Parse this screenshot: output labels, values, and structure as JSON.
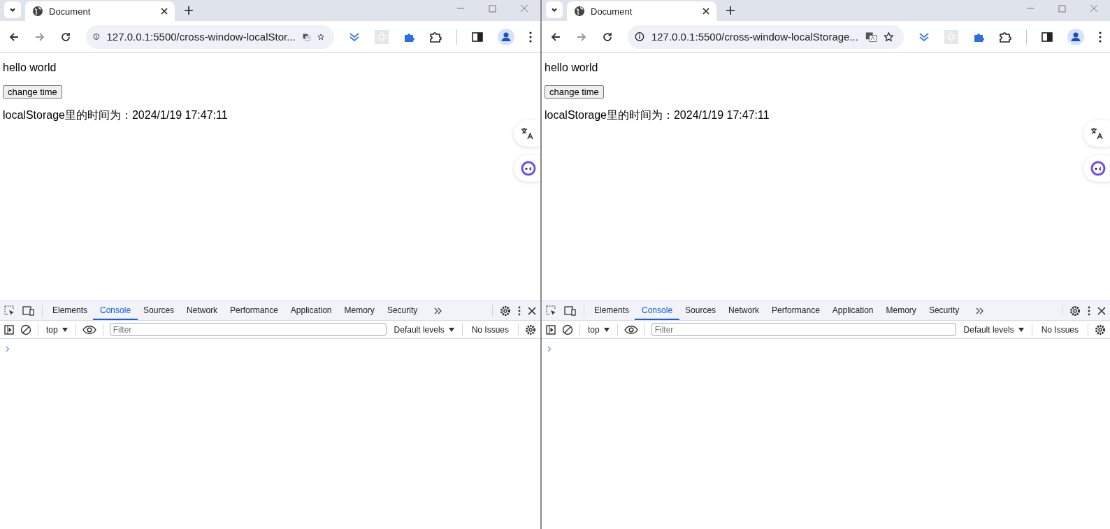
{
  "windows": [
    {
      "tab_title": "Document",
      "url": "127.0.0.1:5500/cross-window-localStor...",
      "page": {
        "heading": "hello world",
        "button": "change time",
        "storage_line": "localStorage里的时间为：2024/1/19 17:47:11"
      },
      "devtools": {
        "tabs": [
          {
            "label": "Elements",
            "selected": false
          },
          {
            "label": "Console",
            "selected": true
          },
          {
            "label": "Sources",
            "selected": false
          },
          {
            "label": "Network",
            "selected": false
          },
          {
            "label": "Performance",
            "selected": false
          },
          {
            "label": "Application",
            "selected": false
          },
          {
            "label": "Memory",
            "selected": false
          },
          {
            "label": "Security",
            "selected": false
          }
        ],
        "context": "top",
        "filter_placeholder": "Filter",
        "levels": "Default levels",
        "issues": "No Issues"
      }
    },
    {
      "tab_title": "Document",
      "url": "127.0.0.1:5500/cross-window-localStorage...",
      "page": {
        "heading": "hello world",
        "button": "change time",
        "storage_line": "localStorage里的时间为：2024/1/19 17:47:11"
      },
      "devtools": {
        "tabs": [
          {
            "label": "Elements",
            "selected": false
          },
          {
            "label": "Console",
            "selected": true
          },
          {
            "label": "Sources",
            "selected": false
          },
          {
            "label": "Network",
            "selected": false
          },
          {
            "label": "Performance",
            "selected": false
          },
          {
            "label": "Application",
            "selected": false
          },
          {
            "label": "Memory",
            "selected": false
          },
          {
            "label": "Security",
            "selected": false
          }
        ],
        "context": "top",
        "filter_placeholder": "Filter",
        "levels": "Default levels",
        "issues": "No Issues"
      }
    }
  ]
}
